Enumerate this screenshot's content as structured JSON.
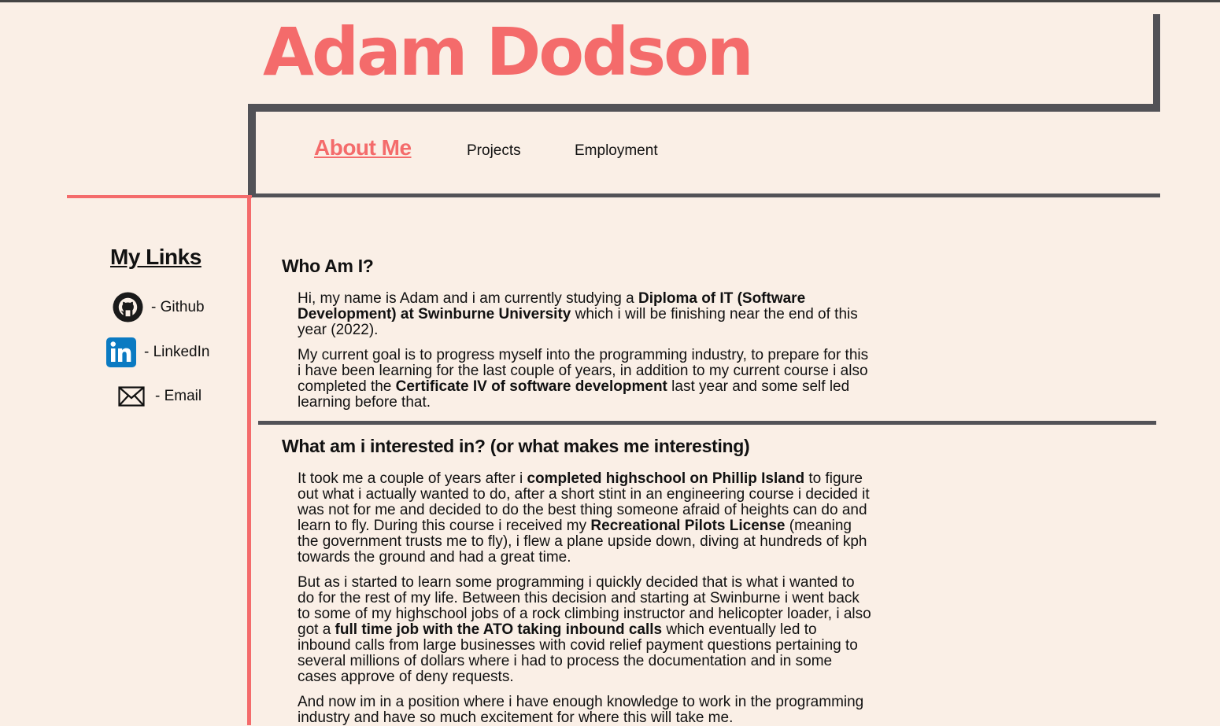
{
  "header": {
    "name": "Adam Dodson"
  },
  "nav": {
    "about": "About Me",
    "projects": "Projects",
    "employment": "Employment"
  },
  "sidebar": {
    "title": "My Links",
    "links": [
      {
        "label": "- Github",
        "icon": "github-icon"
      },
      {
        "label": "- LinkedIn",
        "icon": "linkedin-icon"
      },
      {
        "label": "- Email",
        "icon": "email-icon"
      }
    ]
  },
  "sections": [
    {
      "title": "Who Am I?",
      "paragraphs": [
        [
          {
            "t": "Hi, my name is Adam and i am currently studying a ",
            "b": false
          },
          {
            "t": "Diploma of IT (Software Development) at Swinburne University",
            "b": true
          },
          {
            "t": " which i will be finishing near the end of this year (2022).",
            "b": false
          }
        ],
        [
          {
            "t": "My current goal is to progress myself into the programming industry, to prepare for this i have been learning for the last couple of years, in addition to my current course i also completed the ",
            "b": false
          },
          {
            "t": "Certificate IV of software development",
            "b": true
          },
          {
            "t": " last year and some self led learning before that.",
            "b": false
          }
        ]
      ]
    },
    {
      "title": "What am i interested in? (or what makes me interesting)",
      "paragraphs": [
        [
          {
            "t": "It took me a couple of years after i ",
            "b": false
          },
          {
            "t": "completed highschool on Phillip Island",
            "b": true
          },
          {
            "t": " to figure out what i actually wanted to do, after a short stint in an engineering course i decided it was not for me and decided to do the best thing someone afraid of heights can do and learn to fly. During this course i received my ",
            "b": false
          },
          {
            "t": "Recreational Pilots License",
            "b": true
          },
          {
            "t": " (meaning the government trusts me to fly), i flew a plane upside down, diving at hundreds of kph towards the ground and had a great time.",
            "b": false
          }
        ],
        [
          {
            "t": "But as i started to learn some programming i quickly decided that is what i wanted to do for the rest of my life. Between this decision and starting at Swinburne i went back to some of my highschool jobs of a rock climbing instructor and helicopter loader, i also got a ",
            "b": false
          },
          {
            "t": "full time job with the ATO taking inbound calls",
            "b": true
          },
          {
            "t": " which eventually led to inbound calls from large businesses with covid relief payment questions pertaining to several millions of dollars where i had to process the documentation and in some cases approve of deny requests.",
            "b": false
          }
        ],
        [
          {
            "t": "And now im in a position where i have enough knowledge to work in the programming industry and have so much excitement for where this will take me.",
            "b": false
          }
        ]
      ]
    }
  ],
  "colors": {
    "accent": "#f46b6b",
    "frame": "#525257",
    "background": "#faefe6"
  }
}
